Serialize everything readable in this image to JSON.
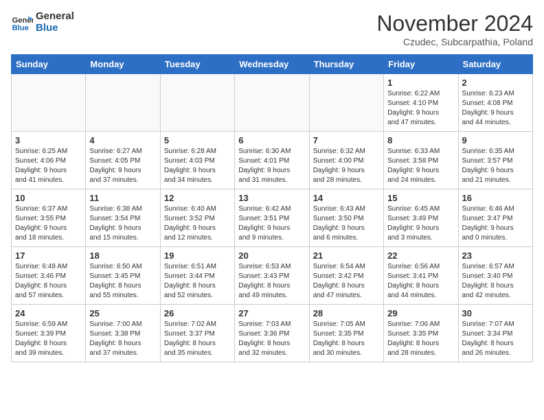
{
  "logo": {
    "line1": "General",
    "line2": "Blue"
  },
  "title": "November 2024",
  "subtitle": "Czudec, Subcarpathia, Poland",
  "days_of_week": [
    "Sunday",
    "Monday",
    "Tuesday",
    "Wednesday",
    "Thursday",
    "Friday",
    "Saturday"
  ],
  "weeks": [
    [
      {
        "day": "",
        "info": "",
        "empty": true
      },
      {
        "day": "",
        "info": "",
        "empty": true
      },
      {
        "day": "",
        "info": "",
        "empty": true
      },
      {
        "day": "",
        "info": "",
        "empty": true
      },
      {
        "day": "",
        "info": "",
        "empty": true
      },
      {
        "day": "1",
        "info": "Sunrise: 6:22 AM\nSunset: 4:10 PM\nDaylight: 9 hours\nand 47 minutes."
      },
      {
        "day": "2",
        "info": "Sunrise: 6:23 AM\nSunset: 4:08 PM\nDaylight: 9 hours\nand 44 minutes."
      }
    ],
    [
      {
        "day": "3",
        "info": "Sunrise: 6:25 AM\nSunset: 4:06 PM\nDaylight: 9 hours\nand 41 minutes."
      },
      {
        "day": "4",
        "info": "Sunrise: 6:27 AM\nSunset: 4:05 PM\nDaylight: 9 hours\nand 37 minutes."
      },
      {
        "day": "5",
        "info": "Sunrise: 6:28 AM\nSunset: 4:03 PM\nDaylight: 9 hours\nand 34 minutes."
      },
      {
        "day": "6",
        "info": "Sunrise: 6:30 AM\nSunset: 4:01 PM\nDaylight: 9 hours\nand 31 minutes."
      },
      {
        "day": "7",
        "info": "Sunrise: 6:32 AM\nSunset: 4:00 PM\nDaylight: 9 hours\nand 28 minutes."
      },
      {
        "day": "8",
        "info": "Sunrise: 6:33 AM\nSunset: 3:58 PM\nDaylight: 9 hours\nand 24 minutes."
      },
      {
        "day": "9",
        "info": "Sunrise: 6:35 AM\nSunset: 3:57 PM\nDaylight: 9 hours\nand 21 minutes."
      }
    ],
    [
      {
        "day": "10",
        "info": "Sunrise: 6:37 AM\nSunset: 3:55 PM\nDaylight: 9 hours\nand 18 minutes."
      },
      {
        "day": "11",
        "info": "Sunrise: 6:38 AM\nSunset: 3:54 PM\nDaylight: 9 hours\nand 15 minutes."
      },
      {
        "day": "12",
        "info": "Sunrise: 6:40 AM\nSunset: 3:52 PM\nDaylight: 9 hours\nand 12 minutes."
      },
      {
        "day": "13",
        "info": "Sunrise: 6:42 AM\nSunset: 3:51 PM\nDaylight: 9 hours\nand 9 minutes."
      },
      {
        "day": "14",
        "info": "Sunrise: 6:43 AM\nSunset: 3:50 PM\nDaylight: 9 hours\nand 6 minutes."
      },
      {
        "day": "15",
        "info": "Sunrise: 6:45 AM\nSunset: 3:49 PM\nDaylight: 9 hours\nand 3 minutes."
      },
      {
        "day": "16",
        "info": "Sunrise: 6:46 AM\nSunset: 3:47 PM\nDaylight: 9 hours\nand 0 minutes."
      }
    ],
    [
      {
        "day": "17",
        "info": "Sunrise: 6:48 AM\nSunset: 3:46 PM\nDaylight: 8 hours\nand 57 minutes."
      },
      {
        "day": "18",
        "info": "Sunrise: 6:50 AM\nSunset: 3:45 PM\nDaylight: 8 hours\nand 55 minutes."
      },
      {
        "day": "19",
        "info": "Sunrise: 6:51 AM\nSunset: 3:44 PM\nDaylight: 8 hours\nand 52 minutes."
      },
      {
        "day": "20",
        "info": "Sunrise: 6:53 AM\nSunset: 3:43 PM\nDaylight: 8 hours\nand 49 minutes."
      },
      {
        "day": "21",
        "info": "Sunrise: 6:54 AM\nSunset: 3:42 PM\nDaylight: 8 hours\nand 47 minutes."
      },
      {
        "day": "22",
        "info": "Sunrise: 6:56 AM\nSunset: 3:41 PM\nDaylight: 8 hours\nand 44 minutes."
      },
      {
        "day": "23",
        "info": "Sunrise: 6:57 AM\nSunset: 3:40 PM\nDaylight: 8 hours\nand 42 minutes."
      }
    ],
    [
      {
        "day": "24",
        "info": "Sunrise: 6:59 AM\nSunset: 3:39 PM\nDaylight: 8 hours\nand 39 minutes."
      },
      {
        "day": "25",
        "info": "Sunrise: 7:00 AM\nSunset: 3:38 PM\nDaylight: 8 hours\nand 37 minutes."
      },
      {
        "day": "26",
        "info": "Sunrise: 7:02 AM\nSunset: 3:37 PM\nDaylight: 8 hours\nand 35 minutes."
      },
      {
        "day": "27",
        "info": "Sunrise: 7:03 AM\nSunset: 3:36 PM\nDaylight: 8 hours\nand 32 minutes."
      },
      {
        "day": "28",
        "info": "Sunrise: 7:05 AM\nSunset: 3:35 PM\nDaylight: 8 hours\nand 30 minutes."
      },
      {
        "day": "29",
        "info": "Sunrise: 7:06 AM\nSunset: 3:35 PM\nDaylight: 8 hours\nand 28 minutes."
      },
      {
        "day": "30",
        "info": "Sunrise: 7:07 AM\nSunset: 3:34 PM\nDaylight: 8 hours\nand 26 minutes."
      }
    ]
  ]
}
